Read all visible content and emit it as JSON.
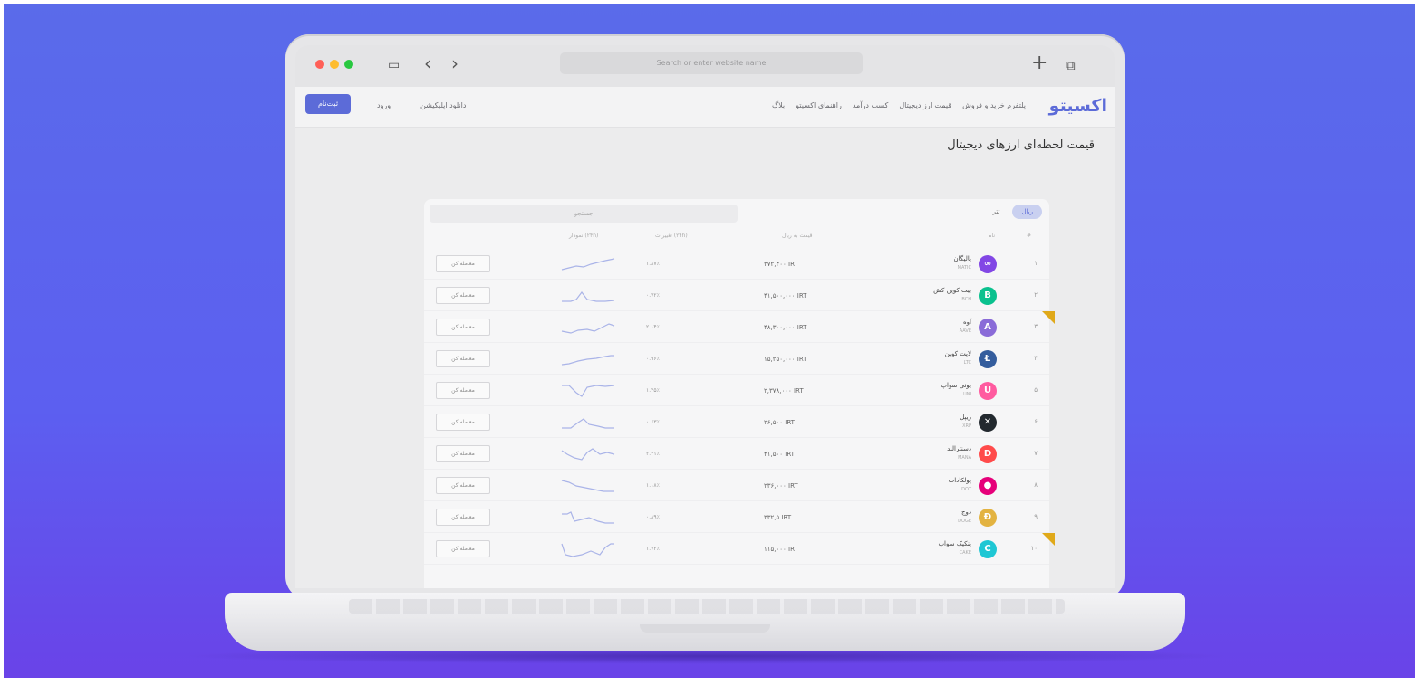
{
  "browser": {
    "url_placeholder": "Search or enter website name",
    "traffic_colors": [
      "#ff5f57",
      "#febc2e",
      "#28c840"
    ]
  },
  "site": {
    "logo": "اکسیتو",
    "nav": [
      "پلتفرم خرید و فروش",
      "قیمت ارز دیجیتال",
      "کسب درآمد",
      "راهنمای اکسیتو",
      "بلاگ"
    ],
    "login_label": "ثبت‌نام",
    "enter_label": "ورود",
    "app_download_label": "دانلود اپلیکیشن",
    "accent": "#5c6bd8"
  },
  "page": {
    "title": "قیمت لحظه‌ای ارزهای دیجیتال"
  },
  "table": {
    "tabs": [
      {
        "label": "ریال",
        "active": true
      },
      {
        "label": "تتر",
        "active": false
      }
    ],
    "search_placeholder": "جستجو",
    "headers": {
      "name": "نام",
      "price": "قیمت به ریال",
      "change": "تغییرات (۲۴h)",
      "chart": "نمودار (۲۴h)"
    },
    "trade_label": "معامله کن",
    "rows": [
      {
        "rank": "۱",
        "name": "پالیگان",
        "symbol": "MATIC",
        "price": "۳۷۲,۴۰۰ IRT",
        "change": "۱.۸۷٪",
        "icon_color": "#8247e5",
        "icon_glyph": "∞",
        "badge": false
      },
      {
        "rank": "۲",
        "name": "بیت کوین کش",
        "symbol": "BCH",
        "price": "۴۱,۵۰۰,۰۰۰ IRT",
        "change": "۰.۷۲٪",
        "icon_color": "#0ac18e",
        "icon_glyph": "B",
        "badge": false
      },
      {
        "rank": "۳",
        "name": "آوه",
        "symbol": "AAVE",
        "price": "۴۸,۳۰۰,۰۰۰ IRT",
        "change": "۲.۱۴٪",
        "icon_color": "#8a6bd8",
        "icon_glyph": "A",
        "badge": true
      },
      {
        "rank": "۴",
        "name": "لایت کوین",
        "symbol": "LTC",
        "price": "۱۵,۲۵۰,۰۰۰ IRT",
        "change": "۰.۹۶٪",
        "icon_color": "#345d9d",
        "icon_glyph": "Ł",
        "badge": false
      },
      {
        "rank": "۵",
        "name": "یونی سواپ",
        "symbol": "UNI",
        "price": "۲,۳۷۸,۰۰۰ IRT",
        "change": "۱.۴۵٪",
        "icon_color": "#ff5ba0",
        "icon_glyph": "U",
        "badge": false
      },
      {
        "rank": "۶",
        "name": "ریپل",
        "symbol": "XRP",
        "price": "۲۶,۵۰۰ IRT",
        "change": "۰.۶۳٪",
        "icon_color": "#23292f",
        "icon_glyph": "✕",
        "badge": false
      },
      {
        "rank": "۷",
        "name": "دسنترالند",
        "symbol": "MANA",
        "price": "۴۱,۵۰۰ IRT",
        "change": "۲.۳۱٪",
        "icon_color": "#ff4b4b",
        "icon_glyph": "D",
        "badge": false
      },
      {
        "rank": "۸",
        "name": "پولکادات",
        "symbol": "DOT",
        "price": "۲۳۶,۰۰۰ IRT",
        "change": "۱.۱۸٪",
        "icon_color": "#e6007a",
        "icon_glyph": "●",
        "badge": false
      },
      {
        "rank": "۹",
        "name": "دوج",
        "symbol": "DOGE",
        "price": "۳۳۲,۵ IRT",
        "change": "۰.۸۹٪",
        "icon_color": "#e3b341",
        "icon_glyph": "Ð",
        "badge": false
      },
      {
        "rank": "۱۰",
        "name": "پنکیک سواپ",
        "symbol": "CAKE",
        "price": "۱۱۵,۰۰۰ IRT",
        "change": "۱.۷۲٪",
        "icon_color": "#1fc7d4",
        "icon_glyph": "C",
        "badge": true
      }
    ]
  }
}
